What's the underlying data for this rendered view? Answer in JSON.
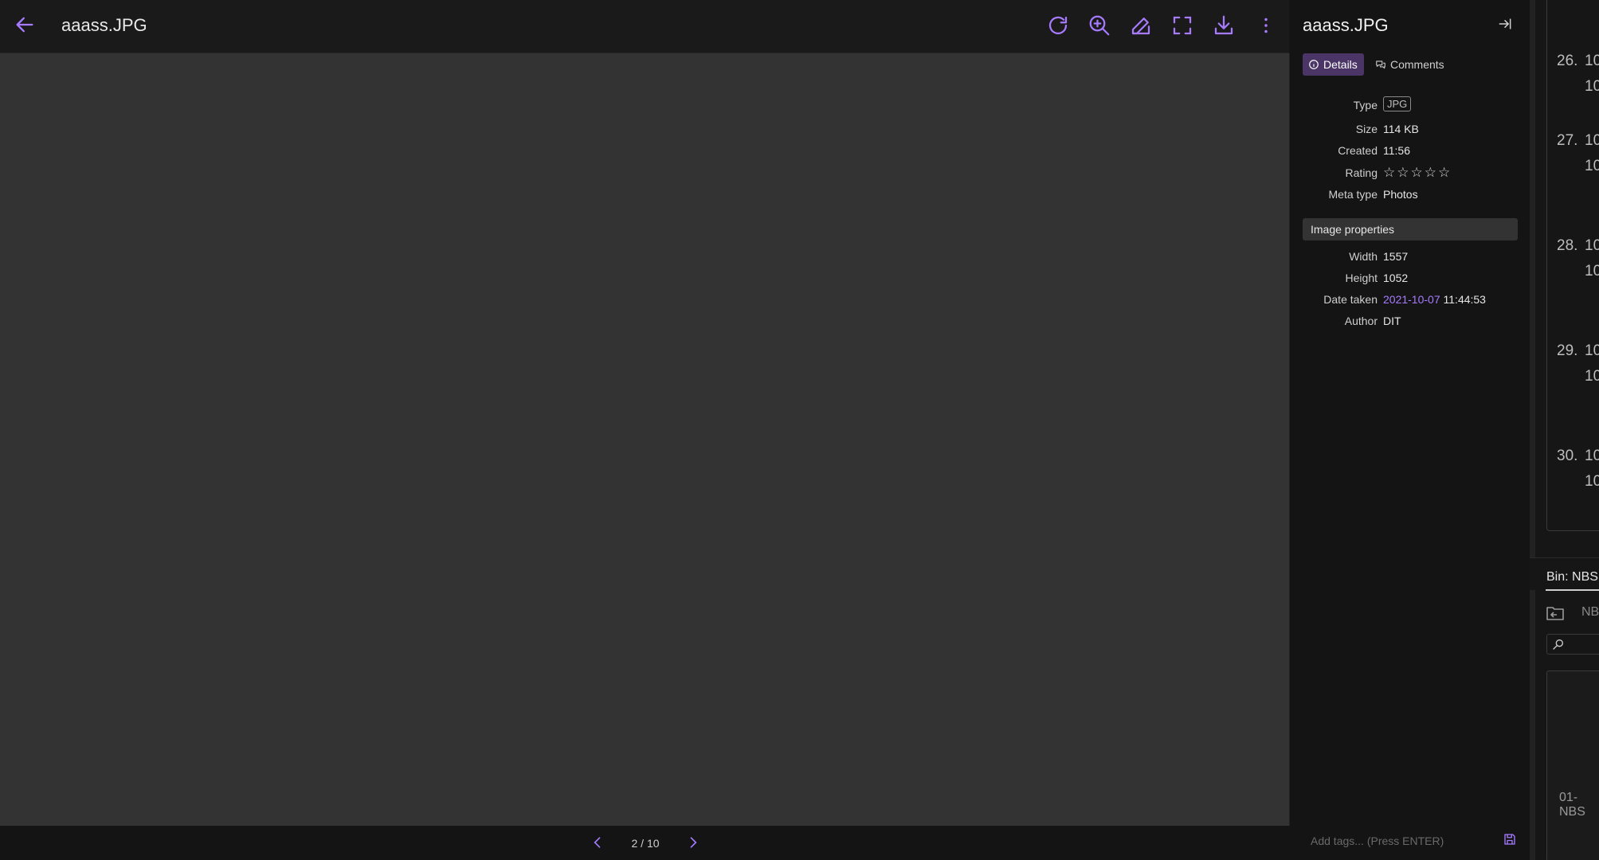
{
  "viewer": {
    "title": "aaass.JPG",
    "pager": {
      "prev": "‹",
      "next": "›",
      "count": "2 / 10"
    }
  },
  "panel": {
    "title": "aaass.JPG",
    "tabs": [
      {
        "label": "Details",
        "active": true
      },
      {
        "label": "Comments",
        "active": false
      }
    ],
    "details": {
      "type_label": "Type",
      "type_value": "JPG",
      "size_label": "Size",
      "size_value": "114 KB",
      "created_label": "Created",
      "created_value": "11:56",
      "rating_label": "Rating",
      "rating_value": 0,
      "rating_max": 5,
      "meta_label": "Meta type",
      "meta_value": "Photos"
    },
    "image_properties": {
      "section_label": "Image properties",
      "width_label": "Width",
      "width_value": "1557",
      "height_label": "Height",
      "height_value": "1052",
      "date_label": "Date taken",
      "date_value": "2021-10-07",
      "time_value": "11:44:53",
      "author_label": "Author",
      "author_value": "DIT"
    },
    "tags": {
      "placeholder": "Add tags... (Press ENTER)"
    }
  },
  "background_app": {
    "rows": [
      {
        "num": "26.",
        "val1": "10",
        "val2": "10"
      },
      {
        "num": "27.",
        "val1": "10",
        "val2": "10"
      },
      {
        "num": "28.",
        "val1": "10",
        "val2": "10"
      },
      {
        "num": "29.",
        "val1": "10",
        "val2": "10"
      },
      {
        "num": "30.",
        "val1": "10",
        "val2": "10"
      }
    ],
    "bin_label": "Bin: NBS",
    "bin_folder_text": "NB",
    "thumb_label": "01-NBS"
  },
  "icons": {
    "back": "arrow-left-icon",
    "rotate": "rotate-icon",
    "zoom": "zoom-in-icon",
    "edit": "edit-icon",
    "fullscreen": "fullscreen-icon",
    "download": "download-icon",
    "more": "more-vertical-icon",
    "close_panel": "collapse-panel-icon",
    "info": "info-icon",
    "comments": "comments-icon",
    "save": "save-icon"
  },
  "colors": {
    "accent": "#a67bff",
    "active_tab": "#4a3566",
    "canvas": "#333333",
    "header": "#1a1a1a"
  }
}
